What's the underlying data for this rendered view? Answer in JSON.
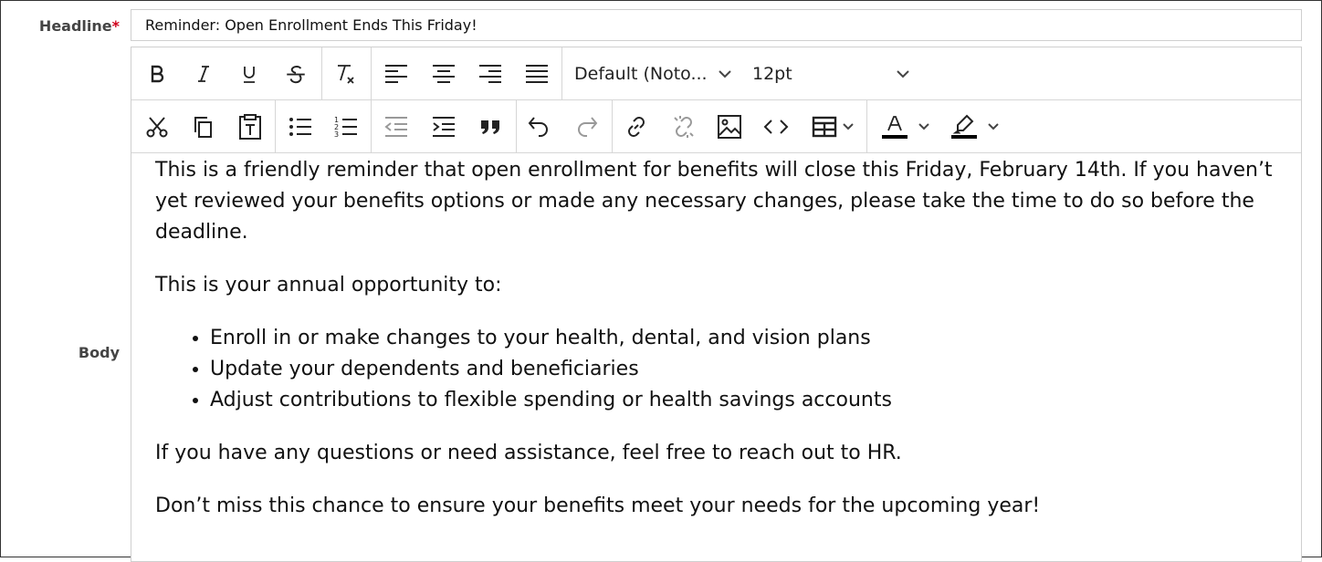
{
  "form": {
    "headline_label": "Headline",
    "required_marker": "*",
    "headline_value": "Reminder: Open Enrollment Ends This Friday!",
    "body_label": "Body"
  },
  "toolbar": {
    "font_family": "Default (Noto...",
    "font_size": "12pt",
    "icons_row1": [
      "bold-icon",
      "italic-icon",
      "underline-icon",
      "strikethrough-icon",
      "clear-formatting-icon",
      "align-left-icon",
      "align-center-icon",
      "align-right-icon",
      "align-justify-icon"
    ],
    "icons_row2": [
      "cut-icon",
      "copy-icon",
      "paste-text-icon",
      "bullet-list-icon",
      "numbered-list-icon",
      "outdent-icon",
      "indent-icon",
      "blockquote-icon",
      "undo-icon",
      "redo-icon",
      "link-icon",
      "unlink-icon",
      "image-icon",
      "code-icon",
      "table-icon",
      "text-color-icon",
      "highlight-color-icon"
    ]
  },
  "body": {
    "p1": "This is a friendly reminder that open enrollment for benefits will close this Friday, February 14th. If you haven’t yet reviewed your benefits options or made any necessary changes, please take the time to do so before the deadline.",
    "p2": "This is your annual opportunity to:",
    "list": [
      "Enroll in or make changes to your health, dental, and vision plans",
      "Update your dependents and beneficiaries",
      "Adjust contributions to flexible spending or health savings accounts"
    ],
    "p3": "If you have any questions or need assistance, feel free to reach out to HR.",
    "p4": "Don’t miss this chance to ensure your benefits meet your needs for the upcoming year!"
  },
  "colors": {
    "required": "#d0021b",
    "text_color_bar": "#000000",
    "highlight_bar": "#000000"
  }
}
